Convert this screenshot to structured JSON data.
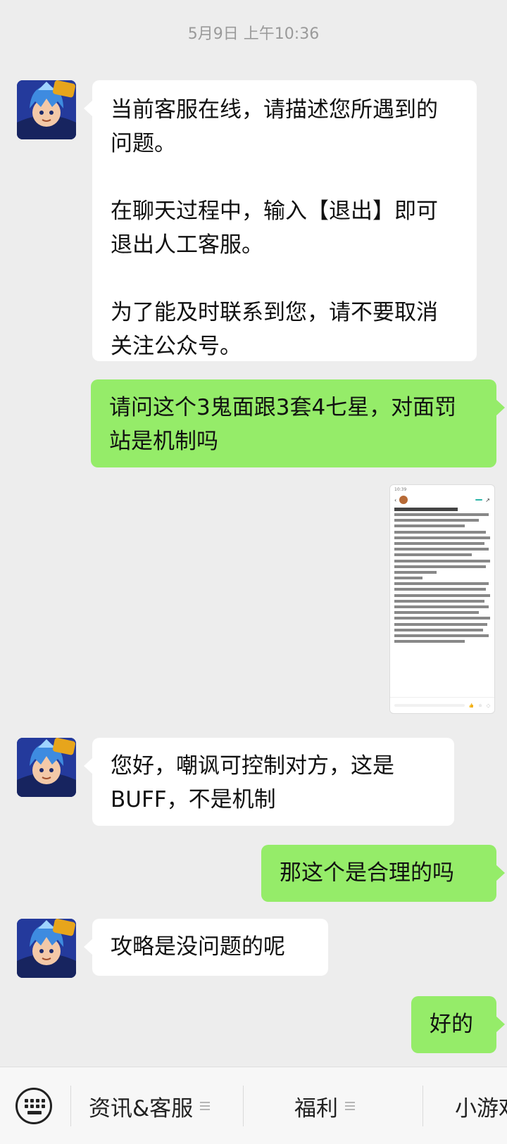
{
  "timestamp": "5月9日 上午10:36",
  "messages": [
    {
      "side": "in",
      "text": "当前客服在线，请描述您所遇到的问题。\n\n在聊天过程中，输入【退出】即可退出人工客服。\n\n为了能及时联系到您，请不要取消关注公众号。"
    },
    {
      "side": "out",
      "text": "请问这个3鬼面跟3套4七星，对面罚站是机制吗"
    },
    {
      "side": "in",
      "text": "您好，嘲讽可控制对方，这是BUFF，不是机制"
    },
    {
      "side": "out",
      "text": "那这个是合理的吗"
    },
    {
      "side": "in",
      "text": "攻略是没问题的呢"
    },
    {
      "side": "out",
      "text": "好的"
    }
  ],
  "avatar_badge": "单机",
  "menu": {
    "items": [
      {
        "label": "资讯&客服"
      },
      {
        "label": "福利"
      },
      {
        "label": "小游戏"
      }
    ]
  },
  "colors": {
    "background": "#ededed",
    "incoming": "#ffffff",
    "outgoing": "#95ec69"
  }
}
